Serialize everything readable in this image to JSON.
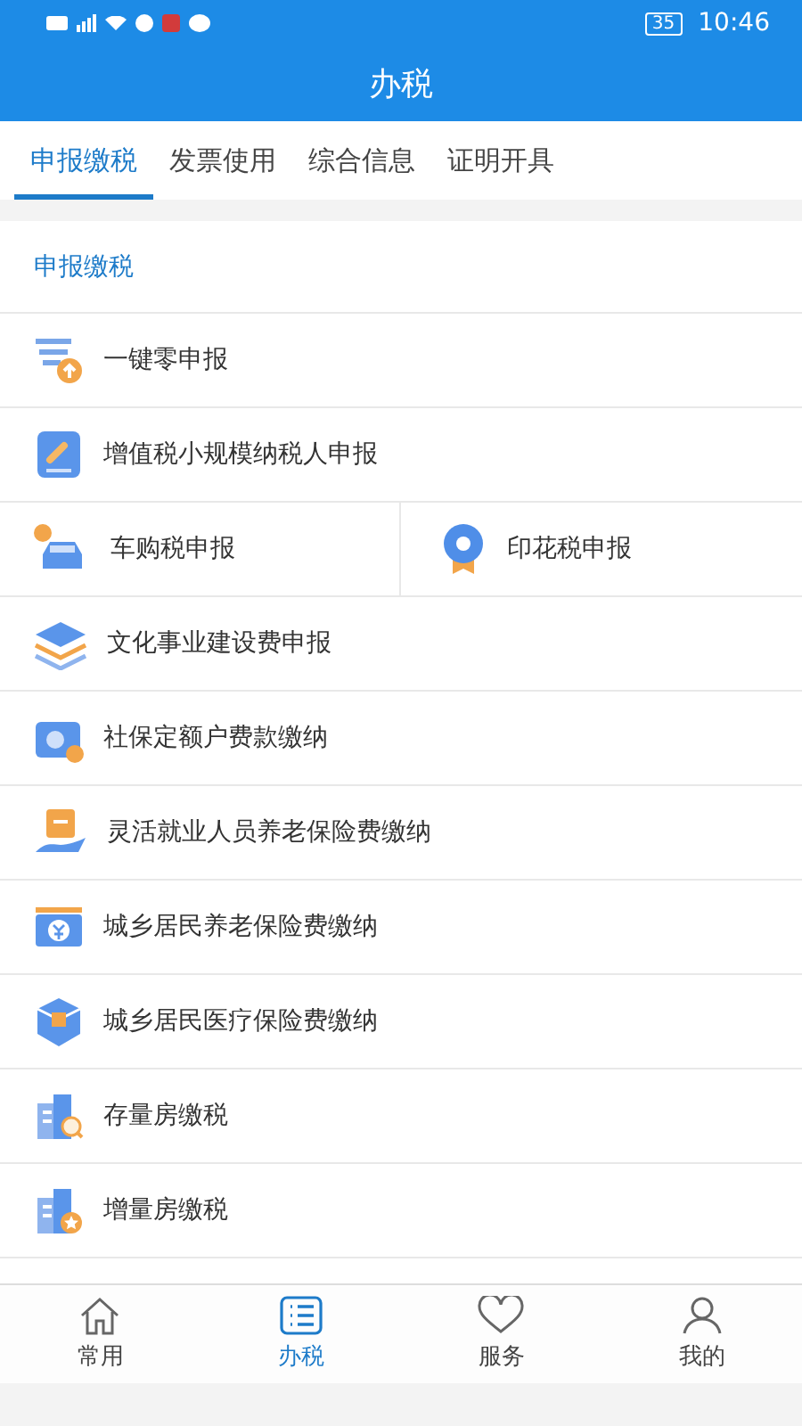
{
  "status_bar": {
    "battery": "35",
    "time": "10:46"
  },
  "header": {
    "title": "办税"
  },
  "tabs": [
    {
      "label": "申报缴税",
      "selected": true
    },
    {
      "label": "发票使用",
      "selected": false
    },
    {
      "label": "综合信息",
      "selected": false
    },
    {
      "label": "证明开具",
      "selected": false
    }
  ],
  "section": {
    "title": "申报缴税",
    "rows": [
      {
        "kind": "single",
        "items": [
          "一键零申报"
        ]
      },
      {
        "kind": "single",
        "items": [
          "增值税小规模纳税人申报"
        ]
      },
      {
        "kind": "pair",
        "items": [
          "车购税申报",
          "印花税申报"
        ]
      },
      {
        "kind": "single",
        "items": [
          "文化事业建设费申报"
        ]
      },
      {
        "kind": "single",
        "items": [
          "社保定额户费款缴纳"
        ]
      },
      {
        "kind": "single",
        "items": [
          "灵活就业人员养老保险费缴纳"
        ]
      },
      {
        "kind": "single",
        "items": [
          "城乡居民养老保险费缴纳"
        ]
      },
      {
        "kind": "single",
        "items": [
          "城乡居民医疗保险费缴纳"
        ]
      },
      {
        "kind": "single",
        "items": [
          "存量房缴税"
        ]
      },
      {
        "kind": "single",
        "items": [
          "增量房缴税"
        ]
      }
    ]
  },
  "bottom_nav": [
    {
      "label": "常用",
      "selected": false
    },
    {
      "label": "办税",
      "selected": true
    },
    {
      "label": "服务",
      "selected": false
    },
    {
      "label": "我的",
      "selected": false
    }
  ]
}
